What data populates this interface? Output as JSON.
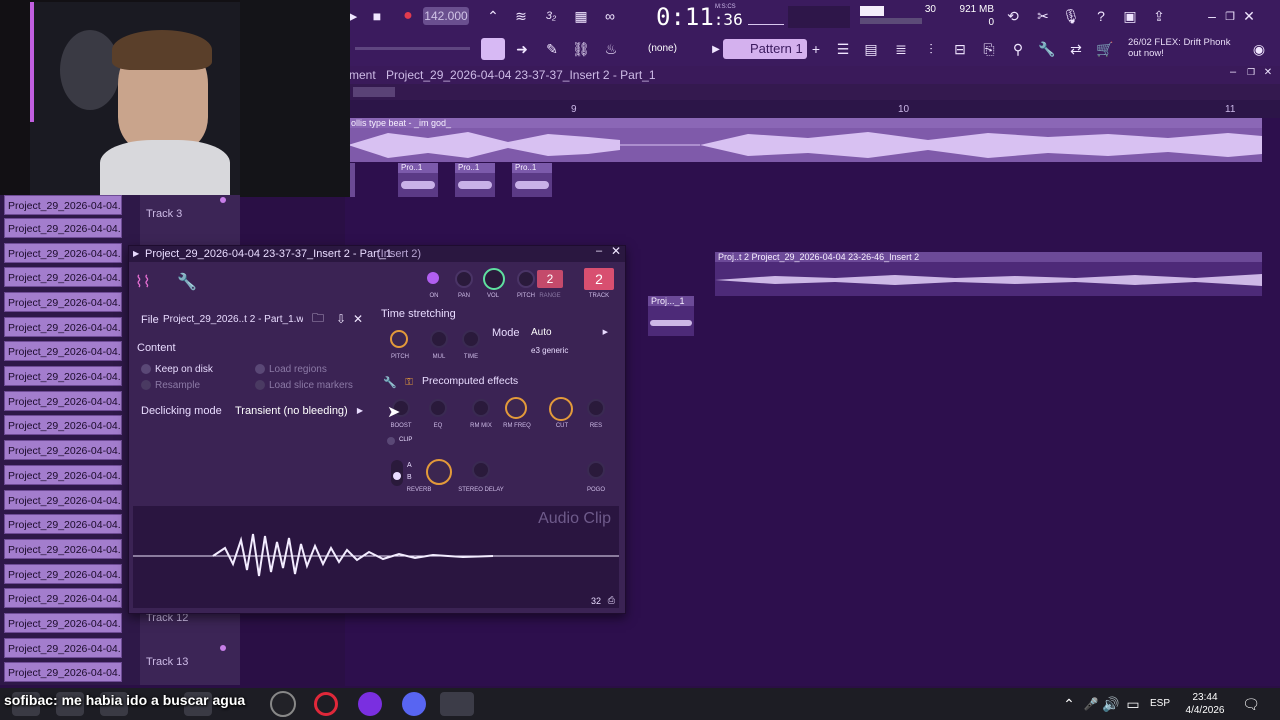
{
  "topbar": {
    "tempo": "142.000",
    "time": "0:11",
    "time_sub": ":36",
    "time_label": "M:S:CS",
    "cpu_value": "30",
    "memory": "921 MB",
    "memory_sub": "0",
    "pattern_selector": "(none)",
    "pattern": "Pattern 1",
    "news_text": "26/02  FLEX: Drift Phonk",
    "news_sub": "out now!"
  },
  "playlist": {
    "title_prefix": "ment",
    "title": "Project_29_2026-04-04 23-37-37_Insert 2 - Part_1",
    "ruler_marks": [
      "9",
      "10",
      "11"
    ],
    "top_clip_title": "ollis type beat - _im god_",
    "small_clips": [
      "Pro..1",
      "Pro..1",
      "Pro..1"
    ],
    "clip_a_title": "Proj..t 2  Project_29_2026-04-04 23-26-46_Insert 2",
    "clip_b_title": "Proj..._1"
  },
  "sidebar": {
    "items": [
      "Project_29_2026-04-04...",
      "Project_29_2026-04-04...",
      "Project_29_2026-04-04...",
      "Project_29_2026-04-04...",
      "Project_29_2026-04-04...",
      "Project_29_2026-04-04...",
      "Project_29_2026-04-04...",
      "Project_29_2026-04-04...",
      "Project_29_2026-04-04...",
      "Project_29_2026-04-04...",
      "Project_29_2026-04-04...",
      "Project_29_2026-04-04...",
      "Project_29_2026-04-04...",
      "Project_29_2026-04-04...",
      "Project_29_2026-04-04...",
      "Project_29_2026-04-04...",
      "Project_29_2026-04-04...",
      "Project_29_2026-04-04...",
      "Project_29_2026-04-04...",
      "Project_29_2026-04-04..."
    ]
  },
  "tracks": {
    "track3": "Track 3",
    "track12": "Track 12",
    "track13": "Track 13"
  },
  "sampler": {
    "title": "Project_29_2026-04-04 23-37-37_Insert 2 - Part_1",
    "title_suffix": "(Insert 2)",
    "top_knob_labels": [
      "ON",
      "PAN",
      "VOL",
      "PITCH",
      "RANGE",
      "TRACK"
    ],
    "range_value": "2",
    "track_value": "2",
    "file_label": "File",
    "file_name": "Project_29_2026..t 2 - Part_1.wav",
    "content_label": "Content",
    "keep_on_disk": "Keep on disk",
    "resample": "Resample",
    "load_regions": "Load regions",
    "load_slice_markers": "Load slice markers",
    "declicking_label": "Declicking mode",
    "declicking_value": "Transient (no bleeding)",
    "time_stretching": "Time stretching",
    "ts_knob_labels": [
      "PITCH",
      "MUL",
      "TIME"
    ],
    "mode_label": "Mode",
    "mode_value": "Auto",
    "mode_sub": "e3 generic",
    "precomputed": "Precomputed effects",
    "fx_knob_labels": [
      "BOOST",
      "EQ",
      "RM MIX",
      "RM FREQ",
      "CUT",
      "RES"
    ],
    "clip_label": "CLIP",
    "ab_a": "A",
    "ab_b": "B",
    "fx2_knob_labels": [
      "REVERB",
      "STEREO DELAY",
      "POGO"
    ],
    "audio_clip_label": "Audio Clip",
    "zoom_value": "32"
  },
  "taskbar": {
    "caption": "sofibac: me habia ido a buscar agua",
    "language": "ESP",
    "clock_time": "23:44",
    "clock_date": "4/4/2026"
  },
  "colors": {
    "background": "#2a0f45",
    "accent_orange": "#e39a3a",
    "accent_green": "#5fe0a0",
    "accent_pink": "#e06b8a"
  }
}
